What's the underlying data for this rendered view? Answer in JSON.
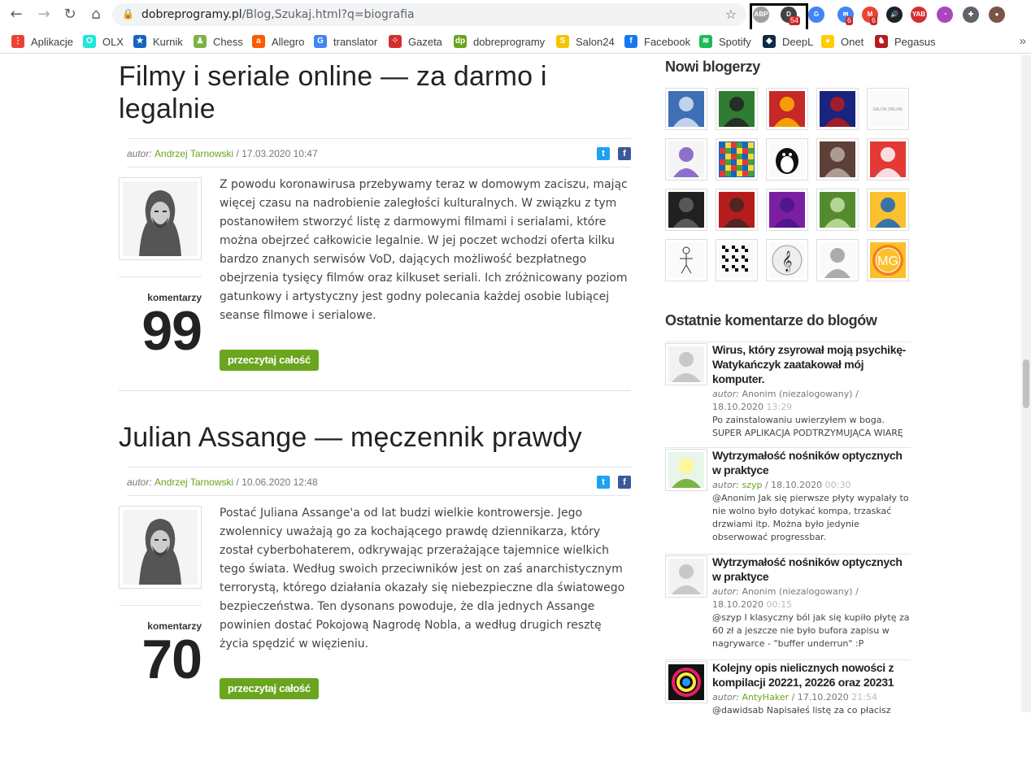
{
  "browser": {
    "url_host": "dobreprogramy.pl",
    "url_path": "/Blog,Szukaj.html?q=biografia",
    "extensions": [
      {
        "name": "abp",
        "label": "ABP",
        "color": "#9e9e9e"
      },
      {
        "name": "tab-counter",
        "label": "D",
        "badge": "54",
        "color": "#424242"
      },
      {
        "name": "translate",
        "label": "G",
        "color": "#4285f4"
      },
      {
        "name": "mail-1",
        "label": "✉",
        "badge": "6",
        "color": "#4285f4"
      },
      {
        "name": "gmail",
        "label": "M",
        "badge": "6",
        "color": "#ea4335"
      },
      {
        "name": "volume",
        "label": "🔊",
        "color": "#202124"
      },
      {
        "name": "yab",
        "label": "YAB",
        "color": "#d32f2f"
      },
      {
        "name": "colorpicker",
        "label": "◔",
        "color": "#ab47bc"
      },
      {
        "name": "puzzle",
        "label": "✚",
        "color": "#5f6368"
      },
      {
        "name": "profile",
        "label": "●",
        "color": "#795548"
      }
    ]
  },
  "bookmarks": [
    {
      "label": "Aplikacje",
      "icon": "apps-grid-icon",
      "color": "#ea4335",
      "glyph": "⋮"
    },
    {
      "label": "OLX",
      "icon": "olx-icon",
      "color": "#23e5db",
      "glyph": "O"
    },
    {
      "label": "Kurnik",
      "icon": "kurnik-star-icon",
      "color": "#1565c0",
      "glyph": "★"
    },
    {
      "label": "Chess",
      "icon": "chess-pawn-icon",
      "color": "#7cb342",
      "glyph": "♟"
    },
    {
      "label": "Allegro",
      "icon": "allegro-icon",
      "color": "#ff5a00",
      "glyph": "a"
    },
    {
      "label": "translator",
      "icon": "translate-icon",
      "color": "#4285f4",
      "glyph": "G"
    },
    {
      "label": "Gazeta",
      "icon": "gazeta-icon",
      "color": "#d32f2f",
      "glyph": "⁘"
    },
    {
      "label": "dobreprogramy",
      "icon": "dp-icon",
      "color": "#6aa51e",
      "glyph": "dp"
    },
    {
      "label": "Salon24",
      "icon": "salon24-icon",
      "color": "#f5c400",
      "glyph": "S"
    },
    {
      "label": "Facebook",
      "icon": "facebook-icon",
      "color": "#1877f2",
      "glyph": "f"
    },
    {
      "label": "Spotify",
      "icon": "spotify-icon",
      "color": "#1db954",
      "glyph": "≋"
    },
    {
      "label": "DeepL",
      "icon": "deepl-icon",
      "color": "#0f2b46",
      "glyph": "◆"
    },
    {
      "label": "Onet",
      "icon": "onet-icon",
      "color": "#ffcc00",
      "glyph": "●"
    },
    {
      "label": "Pegasus",
      "icon": "pegasus-icon",
      "color": "#b71c1c",
      "glyph": "♞"
    }
  ],
  "posts": [
    {
      "title": "Filmy i seriale online — za darmo i legalnie",
      "author_prefix": "autor:",
      "author": "Andrzej Tarnowski",
      "date": "/ 17.03.2020 10:47",
      "excerpt": "Z powodu koronawirusa przebywamy teraz w domowym zaciszu, mając więcej czasu na nadrobienie zaległości kulturalnych. W związku z tym postanowiłem stworzyć listę z darmowymi filmami i serialami, które można obejrzeć całkowicie legalnie. W jej poczet wchodzi oferta kilku bardzo znanych serwisów VoD, dających możliwość bezpłatnego obejrzenia tysięcy filmów oraz kilkuset seriali. Ich zróżnicowany poziom gatunkowy i artystyczny jest godny polecania każdej osobie lubiącej seanse filmowe i serialowe.",
      "comments_label": "komentarzy",
      "comments_count": "99",
      "read_more": "przeczytaj całość"
    },
    {
      "title": "Julian Assange — męczennik prawdy",
      "author_prefix": "autor:",
      "author": "Andrzej Tarnowski",
      "date": "/ 10.06.2020 12:48",
      "excerpt": "Postać Juliana Assange'a od lat budzi wielkie kontrowersje. Jego zwolennicy uważają go za kochającego prawdę dziennikarza, który został cyberbohaterem, odkrywając przerażające tajemnice wielkich tego świata. Według swoich przeciwników jest on zaś anarchistycznym terrorystą, którego działania okazały się niebezpieczne dla światowego bezpieczeństwa. Ten dysonans powoduje, że dla jednych Assange powinien dostać Pokojową Nagrodę Nobla, a według drugich resztę życia spędzić w więzieniu.",
      "comments_label": "komentarzy",
      "comments_count": "70",
      "read_more": "przeczytaj całość"
    }
  ],
  "sidebar": {
    "new_bloggers_title": "Nowi blogerzy",
    "bloggers": [
      {
        "name": "desktop-screenshot",
        "colors": [
          "#3f6fb5",
          "#d8e4f5"
        ]
      },
      {
        "name": "sunglasses-man",
        "colors": [
          "#2e7d32",
          "#222"
        ]
      },
      {
        "name": "red-mask-hero",
        "colors": [
          "#c62828",
          "#ffb300"
        ]
      },
      {
        "name": "dark-portrait",
        "colors": [
          "#1a237e",
          "#b71c1c"
        ]
      },
      {
        "name": "salon-online-logo",
        "colors": [
          "#fafafa",
          "#bdbdbd"
        ],
        "text": "SALON ONLINE"
      },
      {
        "name": "cartoon-man",
        "colors": [
          "#f5f5f5",
          "#7e57c2"
        ]
      },
      {
        "name": "pixel-mosaic",
        "colors": [
          "#1565c0",
          "#fdd835"
        ]
      },
      {
        "name": "penguin",
        "colors": [
          "#fafafa",
          "#111"
        ]
      },
      {
        "name": "figure-photo",
        "colors": [
          "#5d4037",
          "#bcaaa4"
        ]
      },
      {
        "name": "red-phone",
        "colors": [
          "#e53935",
          "#fafafa"
        ]
      },
      {
        "name": "dark-silhouette",
        "colors": [
          "#212121",
          "#616161"
        ]
      },
      {
        "name": "bearded-man",
        "colors": [
          "#b71c1c",
          "#3e2723"
        ]
      },
      {
        "name": "purple-pattern",
        "colors": [
          "#7b1fa2",
          "#4a148c"
        ]
      },
      {
        "name": "yoda",
        "colors": [
          "#558b2f",
          "#c5e1a5"
        ]
      },
      {
        "name": "cartoon-pilot",
        "colors": [
          "#fbc02d",
          "#1565c0"
        ]
      },
      {
        "name": "stick-figure",
        "colors": [
          "#fafafa",
          "#333"
        ]
      },
      {
        "name": "qr-code",
        "colors": [
          "#fafafa",
          "#000"
        ]
      },
      {
        "name": "treble-clef",
        "colors": [
          "#fafafa",
          "#444"
        ]
      },
      {
        "name": "eagle-emblem",
        "colors": [
          "#fafafa",
          "#9e9e9e"
        ]
      },
      {
        "name": "mg-logo",
        "colors": [
          "#fbc02d",
          "#f57f17"
        ],
        "text": "MG"
      }
    ],
    "recent_comments_title": "Ostatnie komentarze do blogów",
    "comments": [
      {
        "title": "Wirus, który zsyrował moją psychikę- Watykańczyk zaatakował mój komputer.",
        "author_prefix": "autor:",
        "author": "Anonim (niezalogowany)",
        "date": "/ 18.10.2020",
        "time": "13:29",
        "text": "Po zainstalowaniu uwierzyłem w boga. SUPER APLIKACJA PODTRZYMUJĄCA WIARĘ",
        "avatar": "default"
      },
      {
        "title": "Wytrzymałość nośników optycznych w praktyce",
        "author_prefix": "autor:",
        "author": "szyp",
        "date": "/ 18.10.2020",
        "time": "00:30",
        "text": "@Anonim Jak się pierwsze płyty wypalały to nie wolno było dotykać kompa, trzaskać drzwiami itp. Można było jedynie obserwować progressbar.",
        "avatar": "green"
      },
      {
        "title": "Wytrzymałość nośników optycznych w praktyce",
        "author_prefix": "autor:",
        "author": "Anonim (niezalogowany)",
        "date": "/ 18.10.2020",
        "time": "00:15",
        "text": "@szyp I klasyczny ból jak się kupiło płytę za 60 zł a jeszcze nie było bufora zapisu w nagrywarce - \"buffer underrun\" :P",
        "avatar": "default"
      },
      {
        "title": "Kolejny opis nielicznych nowości z kompilacji 20221, 20226 oraz 20231",
        "author_prefix": "autor:",
        "author": "AntyHaker",
        "date": "/ 17.10.2020",
        "time": "21:54",
        "text": "@dawidsab Napisałeś listę za co płacisz",
        "avatar": "colorful"
      }
    ]
  }
}
